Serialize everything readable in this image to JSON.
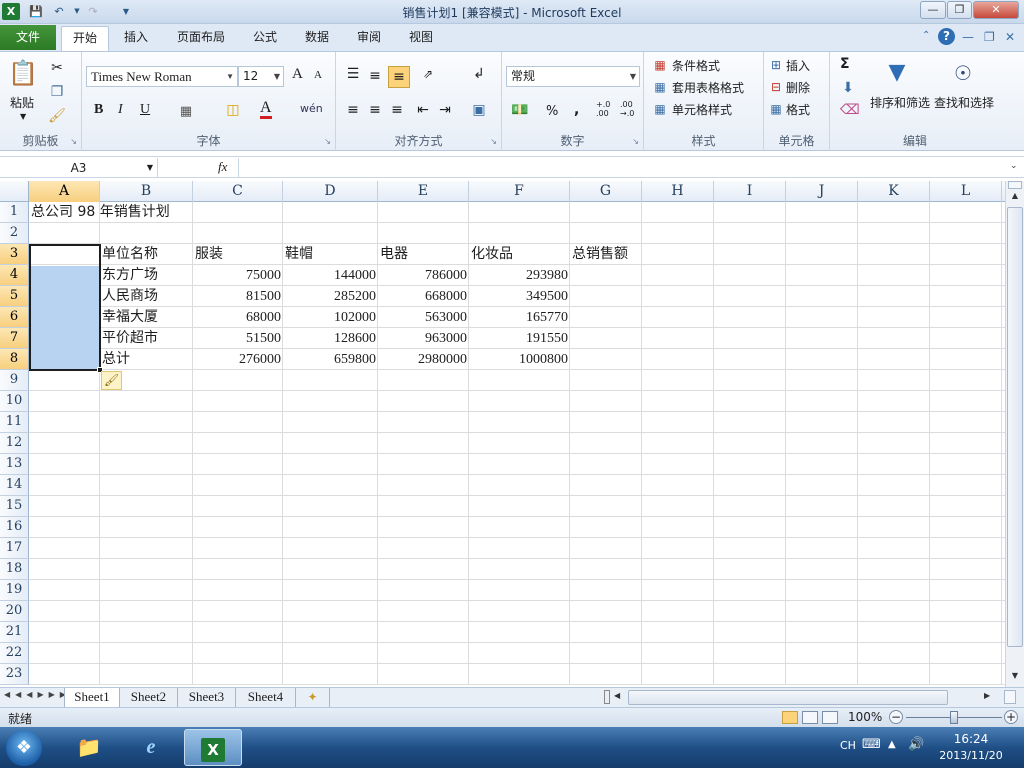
{
  "window": {
    "title": "销售计划1 [兼容模式] - Microsoft Excel"
  },
  "ribbon_tabs": {
    "file": "文件",
    "tabs": [
      "开始",
      "插入",
      "页面布局",
      "公式",
      "数据",
      "审阅",
      "视图"
    ],
    "active": "开始"
  },
  "clipboard": {
    "paste": "粘贴",
    "label": "剪贴板"
  },
  "font": {
    "name": "Times New Roman",
    "size": "12",
    "label": "字体",
    "bold": "B",
    "italic": "I",
    "underline": "U",
    "grow": "A",
    "shrink": "A",
    "color_a": "A",
    "wen": "wén"
  },
  "alignment": {
    "label": "对齐方式"
  },
  "number": {
    "format": "常规",
    "label": "数字",
    "percent": "%",
    "comma": ",",
    "inc_decimal": "+.0 .00",
    "dec_decimal": ".00 →.0"
  },
  "styles": {
    "conditional": "条件格式",
    "table": "套用表格格式",
    "cell": "单元格样式",
    "label": "样式"
  },
  "cells": {
    "insert": "插入",
    "delete": "删除",
    "format": "格式",
    "label": "单元格"
  },
  "editing": {
    "sort": "排序和筛选",
    "find": "查找和选择",
    "label": "编辑",
    "sigma": "Σ"
  },
  "formula_bar": {
    "name_box": "A3",
    "fx": "fx",
    "content": ""
  },
  "columns": [
    "A",
    "B",
    "C",
    "D",
    "E",
    "F",
    "G",
    "H",
    "I",
    "J",
    "K",
    "L"
  ],
  "rows": [
    "1",
    "2",
    "3",
    "4",
    "5",
    "6",
    "7",
    "8",
    "9",
    "10",
    "11",
    "12",
    "13",
    "14",
    "15",
    "16",
    "17",
    "18",
    "19",
    "20",
    "21",
    "22",
    "23"
  ],
  "sheet": {
    "title": "总公司 98 年销售计划",
    "headers": [
      "单位名称",
      "服装",
      "鞋帽",
      "电器",
      "化妆品",
      "总销售额"
    ],
    "data": [
      [
        "东方广场",
        "75000",
        "144000",
        "786000",
        "293980"
      ],
      [
        "人民商场",
        "81500",
        "285200",
        "668000",
        "349500"
      ],
      [
        "幸福大厦",
        "68000",
        "102000",
        "563000",
        "165770"
      ],
      [
        "平价超市",
        "51500",
        "128600",
        "963000",
        "191550"
      ],
      [
        "总计",
        "276000",
        "659800",
        "2980000",
        "1000800"
      ]
    ]
  },
  "sheet_tabs": [
    "Sheet1",
    "Sheet2",
    "Sheet3",
    "Sheet4"
  ],
  "active_sheet": "Sheet1",
  "status": {
    "ready": "就绪",
    "zoom": "100%",
    "zoom_level": 1.0
  },
  "taskbar": {
    "lang": "CH",
    "time": "16:24",
    "date": "2013/11/20"
  }
}
